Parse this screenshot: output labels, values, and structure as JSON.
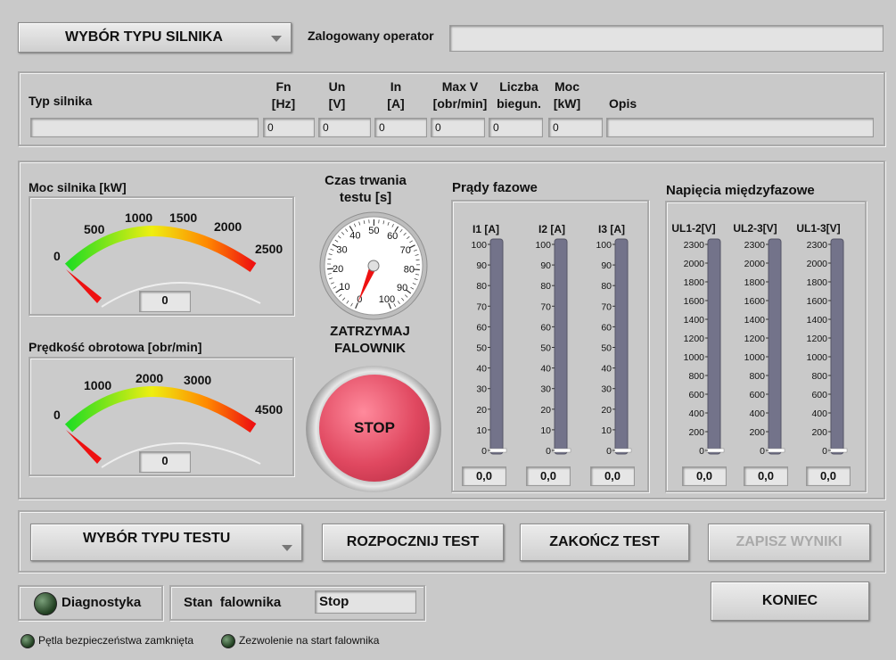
{
  "header": {
    "motor_type_dropdown": "WYBÓR TYPU SILNIKA",
    "operator_label": "Zalogowany operator",
    "operator_value": ""
  },
  "params": {
    "type_label": "Typ silnika",
    "type_value": "",
    "cols": [
      {
        "l1": "Fn",
        "l2": "[Hz]",
        "value": "0"
      },
      {
        "l1": "Un",
        "l2": "[V]",
        "value": "0"
      },
      {
        "l1": "In",
        "l2": "[A]",
        "value": "0"
      },
      {
        "l1": "Max V",
        "l2": "[obr/min]",
        "value": "0"
      },
      {
        "l1": "Liczba",
        "l2": "biegun.",
        "value": "0"
      },
      {
        "l1": "Moc",
        "l2": "[kW]",
        "value": "0"
      }
    ],
    "desc_label": "Opis",
    "desc_value": ""
  },
  "power_gauge": {
    "title": "Moc silnika [kW]",
    "ticks": [
      "0",
      "500",
      "1000",
      "1500",
      "2000",
      "2500"
    ],
    "value": "0",
    "level": 0
  },
  "speed_gauge": {
    "title": "Prędkość obrotowa [obr/min]",
    "ticks": [
      "0",
      "1000",
      "2000",
      "3000",
      "4500"
    ],
    "value": "0",
    "level": 0
  },
  "timer": {
    "title_l1": "Czas trwania",
    "title_l2": "testu [s]",
    "ticks": [
      "0",
      "10",
      "20",
      "30",
      "40",
      "50",
      "60",
      "70",
      "80",
      "90",
      "100"
    ],
    "level": 0
  },
  "stop": {
    "label_l1": "ZATRZYMAJ",
    "label_l2": "FALOWNIK",
    "button": "STOP",
    "color": "#e04860"
  },
  "currents": {
    "title": "Prądy fazowe",
    "scale": [
      "100",
      "90",
      "80",
      "70",
      "60",
      "50",
      "40",
      "30",
      "20",
      "10",
      "0"
    ],
    "channels": [
      {
        "name": "I1 [A]",
        "value": "0,0",
        "level": 0
      },
      {
        "name": "I2 [A]",
        "value": "0,0",
        "level": 0
      },
      {
        "name": "I3 [A]",
        "value": "0,0",
        "level": 0
      }
    ]
  },
  "voltages": {
    "title": "Napięcia międzyfazowe",
    "scale": [
      "2300",
      "2000",
      "1800",
      "1600",
      "1400",
      "1200",
      "1000",
      "800",
      "600",
      "400",
      "200",
      "0"
    ],
    "channels": [
      {
        "name": "UL1-2[V]",
        "value": "0,0",
        "level": 0
      },
      {
        "name": "UL2-3[V]",
        "value": "0,0",
        "level": 0
      },
      {
        "name": "UL1-3[V]",
        "value": "0,0",
        "level": 0
      }
    ]
  },
  "controls": {
    "test_type_dropdown": "WYBÓR TYPU TESTU",
    "start": "ROZPOCZNIJ TEST",
    "finish": "ZAKOŃCZ TEST",
    "save": "ZAPISZ WYNIKI",
    "exit": "KONIEC"
  },
  "status": {
    "diagnostics": "Diagnostyka",
    "inverter_label": "Stan  falownika",
    "inverter_value": "Stop",
    "safety_loop": "Pętla bezpieczeństwa zamknięta",
    "start_permit": "Zezwolenie na start falownika"
  }
}
